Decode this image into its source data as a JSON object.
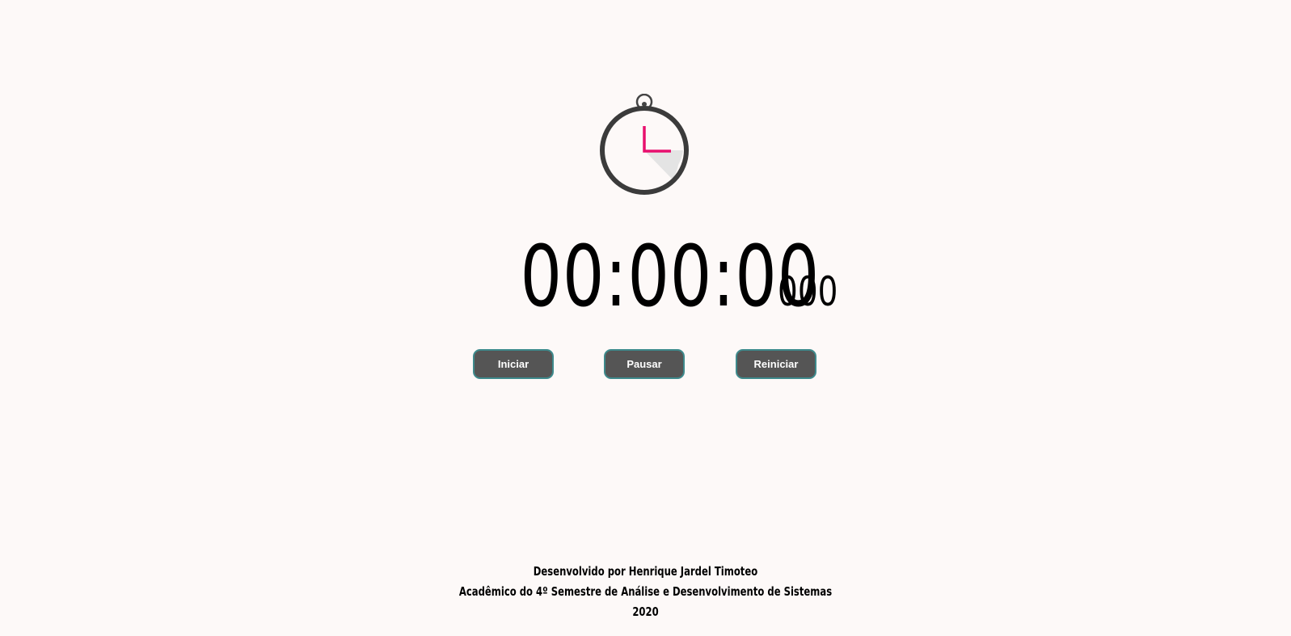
{
  "stopwatch": {
    "icon": "stopwatch-icon",
    "hand_color": "#e8106e",
    "time": "00:00:00",
    "milliseconds": "000"
  },
  "controls": {
    "start_label": "Iniciar",
    "pause_label": "Pausar",
    "reset_label": "Reiniciar"
  },
  "footer": {
    "author": "Desenvolvido por Henrique Jardel Timoteo",
    "course": "Acadêmico do 4º Semestre de Análise e Desenvolvimento de Sistemas",
    "year": "2020"
  }
}
